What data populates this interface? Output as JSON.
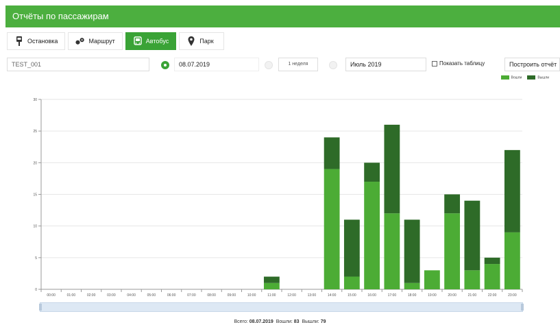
{
  "header": {
    "title": "Отчёты по пассажирам"
  },
  "tabs": [
    {
      "label": "Остановка",
      "icon": "bus-stop-icon",
      "active": false
    },
    {
      "label": "Маршрут",
      "icon": "route-icon",
      "active": false
    },
    {
      "label": "Автобус",
      "icon": "bus-icon",
      "active": true
    },
    {
      "label": "Парк",
      "icon": "map-pin-icon",
      "active": false
    }
  ],
  "toolbar": {
    "vehicle_value": "TEST_001",
    "date_value": "08.07.2019",
    "period_week_label": "1 неделя",
    "month_value": "Июль 2019",
    "show_table_label": "Показать таблицу",
    "build_label": "Построить отчёт"
  },
  "colors": {
    "header": "#4caf3f",
    "entered": "#4cac35",
    "exited": "#2e6b28",
    "active_tab": "#3aa336"
  },
  "chart_data": {
    "type": "bar",
    "stacked": true,
    "categories": [
      "00:00",
      "01:00",
      "02:00",
      "03:00",
      "04:00",
      "05:00",
      "06:00",
      "07:00",
      "08:00",
      "09:00",
      "10:00",
      "11:00",
      "12:00",
      "13:00",
      "14:00",
      "15:00",
      "16:00",
      "17:00",
      "18:00",
      "19:00",
      "20:00",
      "21:00",
      "22:00",
      "23:00"
    ],
    "series": [
      {
        "name": "Вошли",
        "color": "#4cac35",
        "values": [
          0,
          0,
          0,
          0,
          0,
          0,
          0,
          0,
          0,
          0,
          0,
          1,
          0,
          0,
          19,
          2,
          17,
          12,
          1,
          3,
          12,
          3,
          4,
          9
        ]
      },
      {
        "name": "Вышли",
        "color": "#2e6b28",
        "values": [
          0,
          0,
          0,
          0,
          0,
          0,
          0,
          0,
          0,
          0,
          0,
          1,
          0,
          0,
          5,
          9,
          3,
          14,
          10,
          0,
          3,
          11,
          1,
          13
        ]
      }
    ],
    "ylim": [
      0,
      30
    ],
    "yticks": [
      0,
      5,
      10,
      15,
      20,
      25,
      30
    ],
    "grid": true,
    "legend": "top-right"
  },
  "summary": {
    "total_label": "Всего:",
    "date": "08.07.2019",
    "entered_label": "Вошли:",
    "entered": "83",
    "exited_label": "Вышли:",
    "exited": "79"
  }
}
